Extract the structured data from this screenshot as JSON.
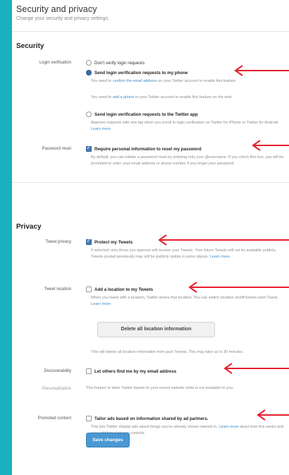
{
  "header": {
    "title": "Security and privacy",
    "subtitle": "Change your security and privacy settings."
  },
  "security": {
    "heading": "Security",
    "login_verification": {
      "label": "Login verification",
      "options": [
        {
          "label": "Don't verify login requests",
          "selected": false
        },
        {
          "label": "Send login verification requests to my phone",
          "selected": true
        },
        {
          "label": "Send login verification requests to the Twitter app",
          "selected": false
        }
      ],
      "help_phone_1_pre": "You need to",
      "help_phone_1_link": "confirm the email address",
      "help_phone_1_post": "on your Twitter account to enable this feature.",
      "help_phone_2_pre": "You need to",
      "help_phone_2_link": "add a phone",
      "help_phone_2_post": "to your Twitter account to enable this feature on the web.",
      "help_app": "Approve requests with one tap when you enroll in login verification on Twitter for iPhone or Twitter for Android.",
      "help_app_link": "Learn more"
    },
    "password_reset": {
      "label": "Password reset",
      "option": "Require personal information to reset my password",
      "checked": true,
      "help": "By default, you can initiate a password reset by entering only your @username. If you check this box, you will be prompted to enter your email address or phone number if you forget your password."
    }
  },
  "privacy": {
    "heading": "Privacy",
    "tweet_privacy": {
      "label": "Tweet privacy",
      "option": "Protect my Tweets",
      "checked": true,
      "help": "If selected, only those you approve will receive your Tweets. Your future Tweets will not be available publicly. Tweets posted previously may still be publicly visible in some places.",
      "help_link": "Learn more"
    },
    "tweet_location": {
      "label": "Tweet location",
      "option": "Add a location to my Tweets",
      "checked": false,
      "help": "When you tweet with a location, Twitter stores that location. You can switch location on/off before each Tweet.",
      "help_link": "Learn more",
      "delete_button": "Delete all location information",
      "delete_help": "This will delete all location information from past Tweets. This may take up to 30 minutes."
    },
    "discoverability": {
      "label": "Discoverability",
      "option": "Let others find me by my email address",
      "checked": false
    },
    "personalization": {
      "label": "Personalization",
      "help": "This feature to tailor Twitter based on your recent website visits is not available to you."
    },
    "promoted_content": {
      "label": "Promoted content",
      "option": "Tailor ads based on information shared by ad partners.",
      "checked": false,
      "help": "This lets Twitter display ads about things you've already shown interest in.",
      "help_link": "Learn more",
      "help_post": "about how this works and your additional privacy controls."
    }
  },
  "save_button": "Save changes",
  "colors": {
    "frame": "#1ab0bf",
    "arrow": "#e5202e",
    "link": "#3b8fd0",
    "save_button": "#4c98d3"
  }
}
